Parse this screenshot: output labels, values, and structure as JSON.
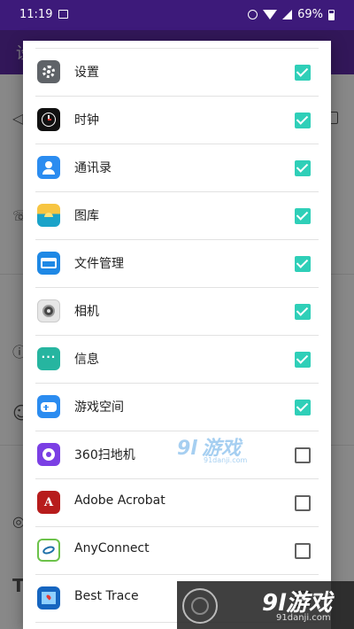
{
  "status_bar": {
    "time": "11:19",
    "battery": "69%",
    "icons": [
      "image-icon",
      "alarm-icon",
      "wifi-icon",
      "signal-icon",
      "battery-icon"
    ]
  },
  "app_bar": {
    "title_partial": "设"
  },
  "dialog": {
    "apps": [
      {
        "label": "设置",
        "icon": "settings-icon",
        "checked": true
      },
      {
        "label": "时钟",
        "icon": "clock-icon",
        "checked": true
      },
      {
        "label": "通讯录",
        "icon": "contacts-icon",
        "checked": true
      },
      {
        "label": "图库",
        "icon": "gallery-icon",
        "checked": true
      },
      {
        "label": "文件管理",
        "icon": "files-icon",
        "checked": true
      },
      {
        "label": "相机",
        "icon": "camera-icon",
        "checked": true
      },
      {
        "label": "信息",
        "icon": "messages-icon",
        "checked": true
      },
      {
        "label": "游戏空间",
        "icon": "gamespace-icon",
        "checked": true
      },
      {
        "label": "360扫地机",
        "icon": "robot-vacuum-icon",
        "checked": false
      },
      {
        "label": "Adobe Acrobat",
        "icon": "acrobat-icon",
        "checked": false
      },
      {
        "label": "AnyConnect",
        "icon": "anyconnect-icon",
        "checked": false
      },
      {
        "label": "Best Trace",
        "icon": "besttrace-icon",
        "checked": false
      }
    ]
  },
  "colors": {
    "status_bar": "#3d1a7a",
    "app_bar": "#5b2aa3",
    "checkbox_checked": "#2fcfb8"
  },
  "watermarks": {
    "middle_brand": "游戏",
    "middle_logo": "9l",
    "middle_site": "91danji.com",
    "corner_brand": "9l游戏",
    "corner_site": "91danji.com"
  }
}
